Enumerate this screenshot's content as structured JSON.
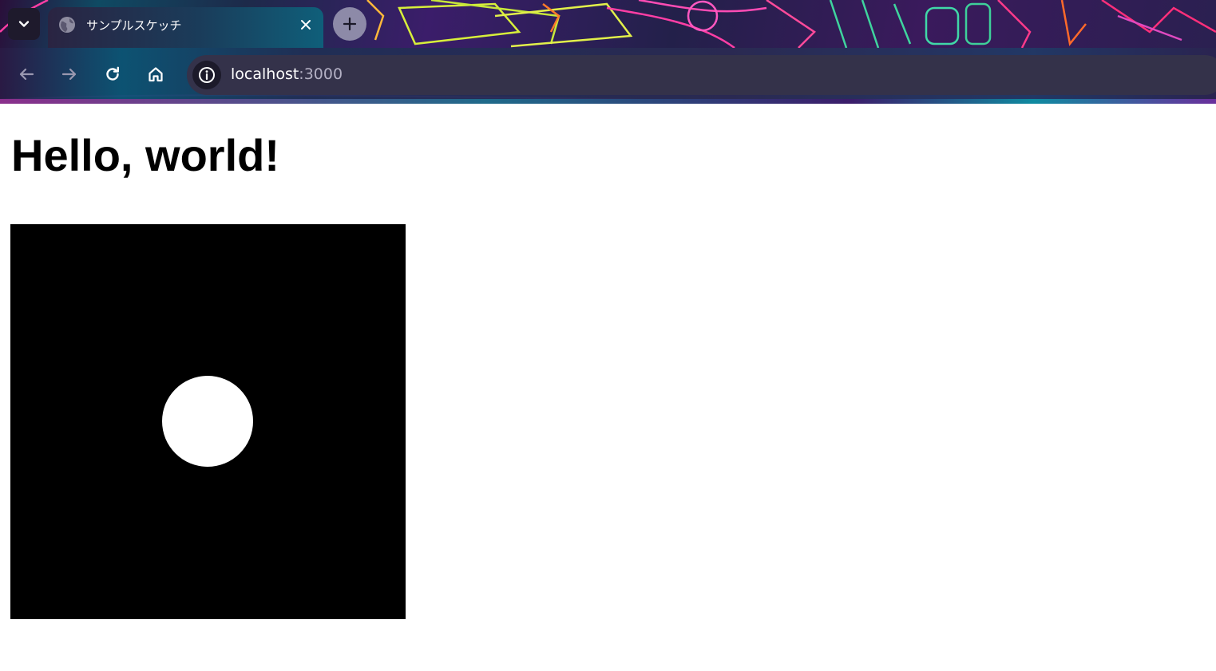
{
  "browser": {
    "tab": {
      "title": "サンプルスケッチ",
      "favicon": "globe-icon"
    },
    "toolbar": {
      "back_icon": "arrow-left-icon",
      "forward_icon": "arrow-right-icon",
      "reload_icon": "reload-icon",
      "home_icon": "home-icon"
    },
    "omnibox": {
      "site_info_icon": "info-icon",
      "host": "localhost",
      "port": ":3000"
    }
  },
  "page": {
    "heading": "Hello, world!",
    "canvas": {
      "background": "#000000",
      "circle_color": "#ffffff"
    }
  },
  "colors": {
    "omnibox_bg": "#34324a",
    "new_tab_button_bg": "#8d8aa8"
  }
}
